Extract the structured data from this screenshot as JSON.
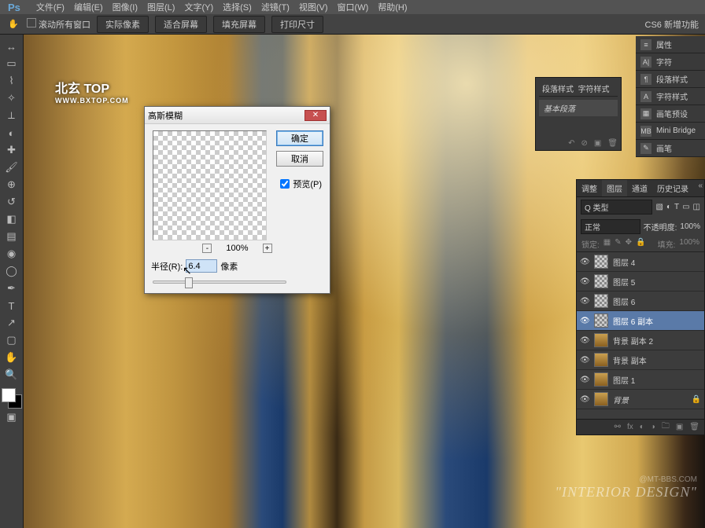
{
  "menu": {
    "items": [
      "文件(F)",
      "编辑(E)",
      "图像(I)",
      "图层(L)",
      "文字(Y)",
      "选择(S)",
      "滤镜(T)",
      "视图(V)",
      "窗口(W)",
      "帮助(H)"
    ]
  },
  "optbar": {
    "scroll_all": "滚动所有窗口",
    "btn1": "实际像素",
    "btn2": "适合屏幕",
    "btn3": "填充屏幕",
    "btn4": "打印尺寸",
    "right": "CS6 新增功能"
  },
  "watermark": {
    "brand": "北玄 TOP",
    "url": "WWW.BXTOP.COM",
    "br_site": "@MT-BBS.COM",
    "br_text": "\"INTERIOR DESIGN\""
  },
  "dialog": {
    "title": "高斯模糊",
    "ok": "确定",
    "cancel": "取消",
    "preview": "预览(P)",
    "zoom": "100%",
    "radius_label": "半径(R):",
    "radius_value": "6.4",
    "radius_unit": "像素"
  },
  "panels": {
    "para": {
      "tab1": "段落样式",
      "tab2": "字符样式",
      "item": "基本段落"
    },
    "mini": [
      "属性",
      "字符",
      "段落样式",
      "字符样式",
      "画笔预设",
      "Mini Bridge",
      "画笔"
    ]
  },
  "layers_panel": {
    "tabs": [
      "调整",
      "图层",
      "通道",
      "历史记录"
    ],
    "kind": "Q 类型",
    "blend": "正常",
    "opacity_lbl": "不透明度:",
    "opacity": "100%",
    "lock_lbl": "锁定:",
    "fill_lbl": "填充:",
    "fill": "100%",
    "layers": [
      {
        "name": "图层 4",
        "checker": true
      },
      {
        "name": "图层 5",
        "checker": true
      },
      {
        "name": "图层 6",
        "checker": true
      },
      {
        "name": "图层 6 副本",
        "checker": true,
        "selected": true
      },
      {
        "name": "背景 副本 2"
      },
      {
        "name": "背景 副本"
      },
      {
        "name": "图层 1"
      },
      {
        "name": "背景",
        "locked": true,
        "italic": true
      }
    ]
  }
}
